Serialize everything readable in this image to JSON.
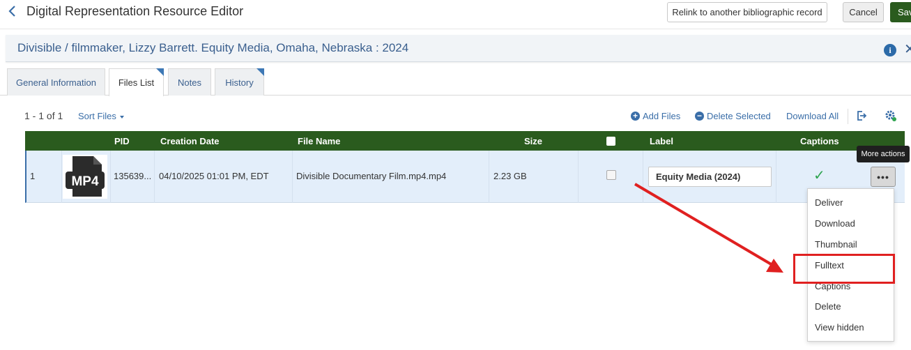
{
  "header": {
    "title": "Digital Representation Resource Editor",
    "relink_label": "Relink to another bibliographic record",
    "cancel_label": "Cancel",
    "save_label": "Save"
  },
  "record": {
    "title": "Divisible / filmmaker, Lizzy Barrett. Equity Media, Omaha, Nebraska : 2024"
  },
  "tabs": [
    {
      "label": "General Information"
    },
    {
      "label": "Files List"
    },
    {
      "label": "Notes"
    },
    {
      "label": "History"
    }
  ],
  "toolbar": {
    "count": "1 - 1 of 1",
    "sort_label": "Sort Files",
    "add_files": "Add Files",
    "delete_selected": "Delete Selected",
    "download_all": "Download All"
  },
  "table": {
    "headers": [
      "PID",
      "Creation Date",
      "File Name",
      "Size",
      "Label",
      "Captions"
    ],
    "rows": [
      {
        "num": "1",
        "thumb_label": "MP4",
        "pid": "135639...",
        "date": "04/10/2025 01:01 PM, EDT",
        "name": "Divisible Documentary Film.mp4.mp4",
        "size": "2.23 GB",
        "label": "Equity Media (2024)",
        "captions": "✓"
      }
    ]
  },
  "tooltip": "More actions",
  "menu": {
    "items": [
      "Deliver",
      "Download",
      "Thumbnail",
      "Fulltext",
      "Captions",
      "Delete",
      "View hidden"
    ]
  },
  "colors": {
    "accent": "#3a6ea8",
    "header_green": "#2a5b1e",
    "annotation_red": "#e02020"
  }
}
